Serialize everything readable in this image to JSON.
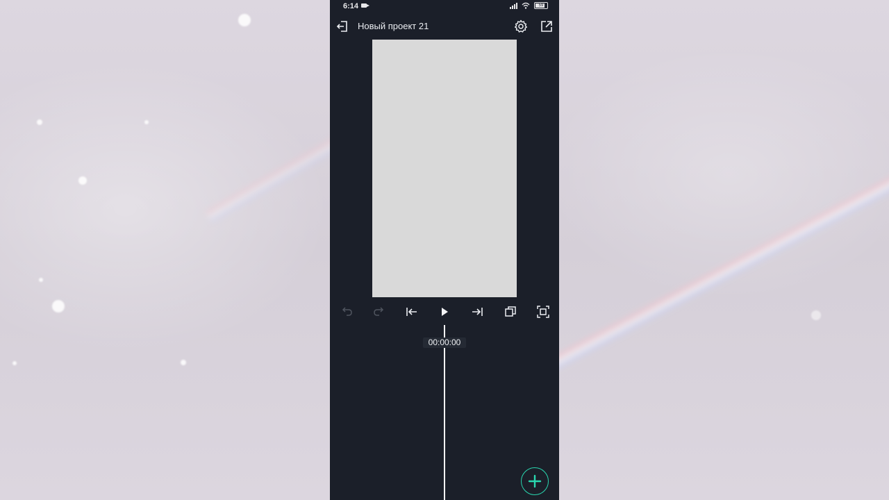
{
  "status_bar": {
    "time": "6:14",
    "battery": "59"
  },
  "app_bar": {
    "title": "Новый проект 21"
  },
  "timeline": {
    "timecode": "00:00:00"
  },
  "colors": {
    "app_background": "#1b1f29",
    "preview_canvas": "#d9d9d9",
    "accent": "#2ad7b0"
  },
  "icons": {
    "exit": "exit-icon",
    "settings": "gear-icon",
    "export": "share-export-icon",
    "undo": "undo-icon",
    "redo": "redo-icon",
    "skip_start": "skip-to-start-icon",
    "play": "play-icon",
    "skip_end": "skip-to-end-icon",
    "copy": "copy-icon",
    "fullscreen": "fullscreen-icon",
    "add": "plus-icon"
  }
}
